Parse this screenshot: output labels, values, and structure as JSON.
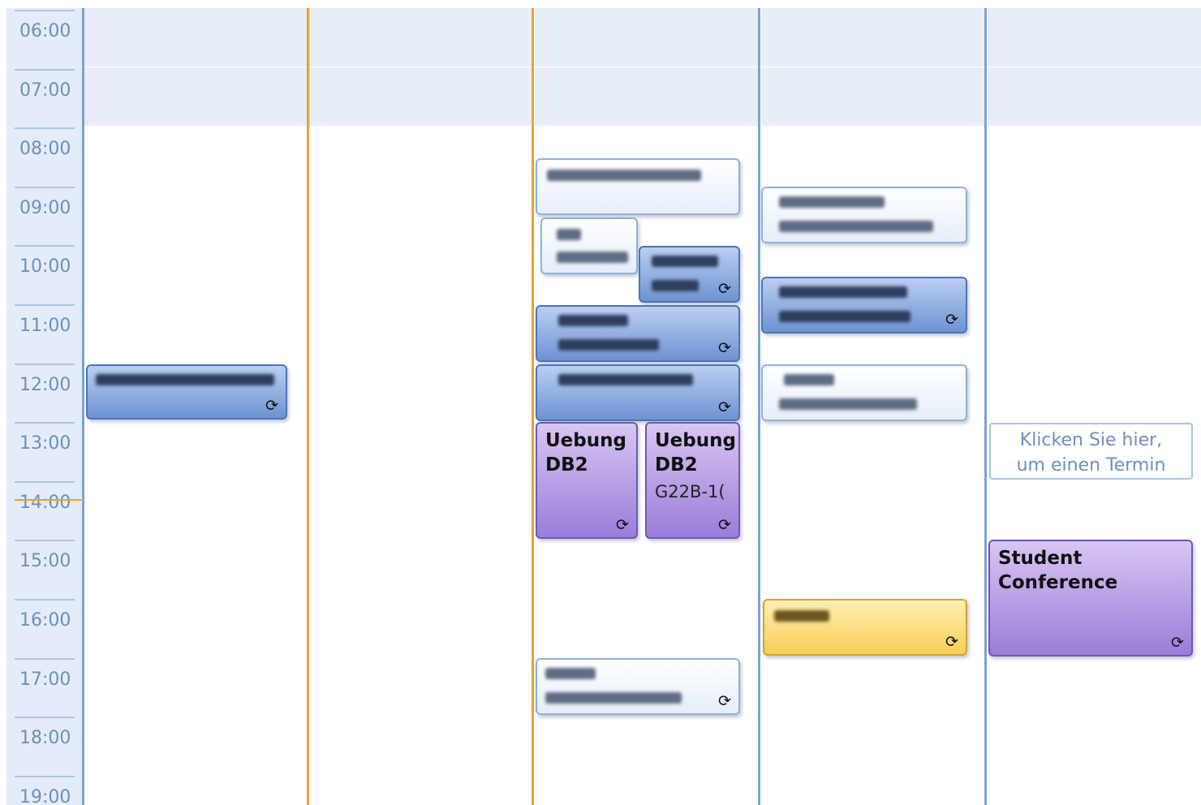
{
  "time_labels": [
    "06:00",
    "07:00",
    "08:00",
    "09:00",
    "10:00",
    "11:00",
    "12:00",
    "13:00",
    "14:00",
    "15:00",
    "16:00",
    "17:00",
    "18:00",
    "19:00"
  ],
  "icons": {
    "recurrence": "recurrence-icon"
  },
  "colors": {
    "today_marker": "#f0a030",
    "column_separator": "#7ca2d4",
    "time_text": "#6d8fc0"
  },
  "appointments": {
    "uebung_db2_a": {
      "title": "Uebung\nDB2"
    },
    "uebung_db2_b": {
      "title": "Uebung\nDB2",
      "location": "G22B-1("
    },
    "student_conference": {
      "title": "Student\nConference"
    }
  },
  "new_appointment_hint": {
    "text": "Klicken Sie hier,\num einen Termin"
  }
}
